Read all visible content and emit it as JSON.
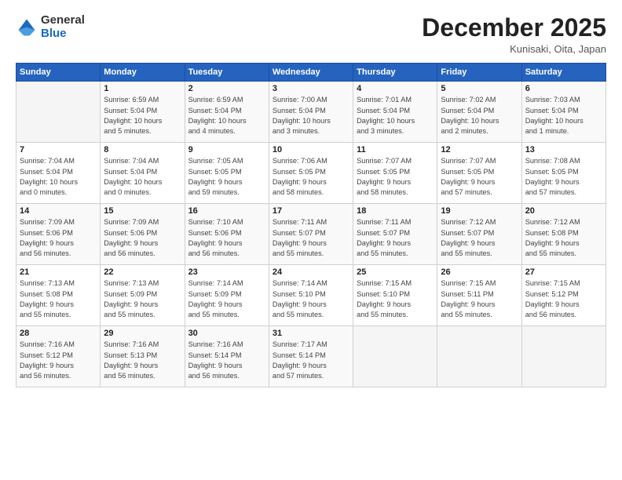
{
  "logo": {
    "general": "General",
    "blue": "Blue"
  },
  "title": "December 2025",
  "subtitle": "Kunisaki, Oita, Japan",
  "header_days": [
    "Sunday",
    "Monday",
    "Tuesday",
    "Wednesday",
    "Thursday",
    "Friday",
    "Saturday"
  ],
  "weeks": [
    [
      {
        "num": "",
        "info": ""
      },
      {
        "num": "1",
        "info": "Sunrise: 6:59 AM\nSunset: 5:04 PM\nDaylight: 10 hours\nand 5 minutes."
      },
      {
        "num": "2",
        "info": "Sunrise: 6:59 AM\nSunset: 5:04 PM\nDaylight: 10 hours\nand 4 minutes."
      },
      {
        "num": "3",
        "info": "Sunrise: 7:00 AM\nSunset: 5:04 PM\nDaylight: 10 hours\nand 3 minutes."
      },
      {
        "num": "4",
        "info": "Sunrise: 7:01 AM\nSunset: 5:04 PM\nDaylight: 10 hours\nand 3 minutes."
      },
      {
        "num": "5",
        "info": "Sunrise: 7:02 AM\nSunset: 5:04 PM\nDaylight: 10 hours\nand 2 minutes."
      },
      {
        "num": "6",
        "info": "Sunrise: 7:03 AM\nSunset: 5:04 PM\nDaylight: 10 hours\nand 1 minute."
      }
    ],
    [
      {
        "num": "7",
        "info": "Sunrise: 7:04 AM\nSunset: 5:04 PM\nDaylight: 10 hours\nand 0 minutes."
      },
      {
        "num": "8",
        "info": "Sunrise: 7:04 AM\nSunset: 5:04 PM\nDaylight: 10 hours\nand 0 minutes."
      },
      {
        "num": "9",
        "info": "Sunrise: 7:05 AM\nSunset: 5:05 PM\nDaylight: 9 hours\nand 59 minutes."
      },
      {
        "num": "10",
        "info": "Sunrise: 7:06 AM\nSunset: 5:05 PM\nDaylight: 9 hours\nand 58 minutes."
      },
      {
        "num": "11",
        "info": "Sunrise: 7:07 AM\nSunset: 5:05 PM\nDaylight: 9 hours\nand 58 minutes."
      },
      {
        "num": "12",
        "info": "Sunrise: 7:07 AM\nSunset: 5:05 PM\nDaylight: 9 hours\nand 57 minutes."
      },
      {
        "num": "13",
        "info": "Sunrise: 7:08 AM\nSunset: 5:05 PM\nDaylight: 9 hours\nand 57 minutes."
      }
    ],
    [
      {
        "num": "14",
        "info": "Sunrise: 7:09 AM\nSunset: 5:06 PM\nDaylight: 9 hours\nand 56 minutes."
      },
      {
        "num": "15",
        "info": "Sunrise: 7:09 AM\nSunset: 5:06 PM\nDaylight: 9 hours\nand 56 minutes."
      },
      {
        "num": "16",
        "info": "Sunrise: 7:10 AM\nSunset: 5:06 PM\nDaylight: 9 hours\nand 56 minutes."
      },
      {
        "num": "17",
        "info": "Sunrise: 7:11 AM\nSunset: 5:07 PM\nDaylight: 9 hours\nand 55 minutes."
      },
      {
        "num": "18",
        "info": "Sunrise: 7:11 AM\nSunset: 5:07 PM\nDaylight: 9 hours\nand 55 minutes."
      },
      {
        "num": "19",
        "info": "Sunrise: 7:12 AM\nSunset: 5:07 PM\nDaylight: 9 hours\nand 55 minutes."
      },
      {
        "num": "20",
        "info": "Sunrise: 7:12 AM\nSunset: 5:08 PM\nDaylight: 9 hours\nand 55 minutes."
      }
    ],
    [
      {
        "num": "21",
        "info": "Sunrise: 7:13 AM\nSunset: 5:08 PM\nDaylight: 9 hours\nand 55 minutes."
      },
      {
        "num": "22",
        "info": "Sunrise: 7:13 AM\nSunset: 5:09 PM\nDaylight: 9 hours\nand 55 minutes."
      },
      {
        "num": "23",
        "info": "Sunrise: 7:14 AM\nSunset: 5:09 PM\nDaylight: 9 hours\nand 55 minutes."
      },
      {
        "num": "24",
        "info": "Sunrise: 7:14 AM\nSunset: 5:10 PM\nDaylight: 9 hours\nand 55 minutes."
      },
      {
        "num": "25",
        "info": "Sunrise: 7:15 AM\nSunset: 5:10 PM\nDaylight: 9 hours\nand 55 minutes."
      },
      {
        "num": "26",
        "info": "Sunrise: 7:15 AM\nSunset: 5:11 PM\nDaylight: 9 hours\nand 55 minutes."
      },
      {
        "num": "27",
        "info": "Sunrise: 7:15 AM\nSunset: 5:12 PM\nDaylight: 9 hours\nand 56 minutes."
      }
    ],
    [
      {
        "num": "28",
        "info": "Sunrise: 7:16 AM\nSunset: 5:12 PM\nDaylight: 9 hours\nand 56 minutes."
      },
      {
        "num": "29",
        "info": "Sunrise: 7:16 AM\nSunset: 5:13 PM\nDaylight: 9 hours\nand 56 minutes."
      },
      {
        "num": "30",
        "info": "Sunrise: 7:16 AM\nSunset: 5:14 PM\nDaylight: 9 hours\nand 56 minutes."
      },
      {
        "num": "31",
        "info": "Sunrise: 7:17 AM\nSunset: 5:14 PM\nDaylight: 9 hours\nand 57 minutes."
      },
      {
        "num": "",
        "info": ""
      },
      {
        "num": "",
        "info": ""
      },
      {
        "num": "",
        "info": ""
      }
    ]
  ]
}
